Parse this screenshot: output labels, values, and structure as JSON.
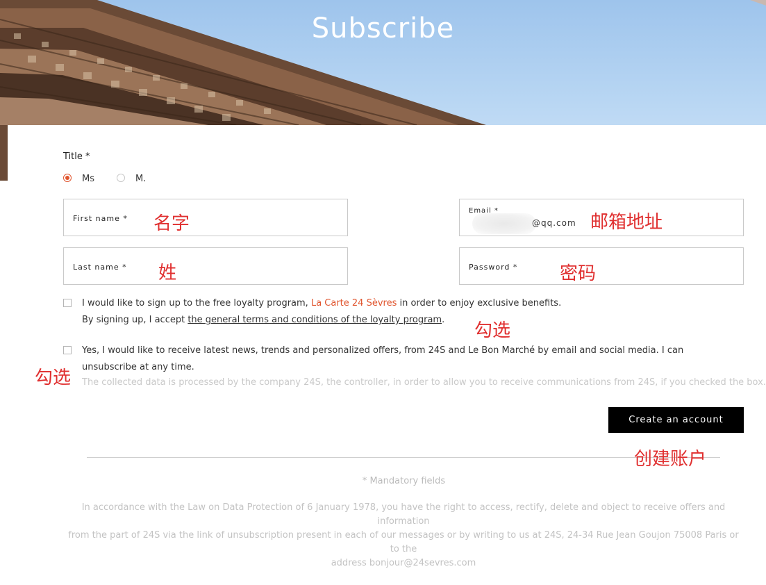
{
  "header": {
    "title": "Subscribe"
  },
  "form": {
    "title_label": "Title *",
    "title_options": [
      {
        "label": "Ms",
        "checked": true
      },
      {
        "label": "M.",
        "checked": false
      }
    ],
    "first_name": {
      "label": "First name *",
      "value": ""
    },
    "last_name": {
      "label": "Last name *",
      "value": ""
    },
    "email": {
      "label": "Email *",
      "value": "@qq.com"
    },
    "password": {
      "label": "Password *",
      "value": ""
    },
    "loyalty": {
      "checked": false,
      "text_before": "I would like to sign up to the free loyalty program, ",
      "program_link": "La Carte 24 Sèvres",
      "text_after": " in order to enjoy exclusive benefits.",
      "accept_before": "By signing up, I accept ",
      "terms_link": "the general terms and conditions of the loyalty program",
      "accept_after": "."
    },
    "newsletter": {
      "checked": false,
      "line1": "Yes, I would like to receive latest news, trends and personalized offers, from 24S and Le Bon Marché by email and social media. I can",
      "line2": "unsubscribe at any time.",
      "note": "The collected data is processed by the company 24S, the controller, in order to allow you to receive communications from 24S, if you checked the box."
    },
    "submit_label": "Create an account"
  },
  "footer": {
    "mandatory": "* Mandatory fields",
    "legal_lines": [
      "In accordance with the Law on Data Protection of 6 January 1978, you have the right to access, rectify, delete and object to receive offers and information",
      "from the part of 24S via the link of unsubscription present in each of our messages or by writing to us at 24S, 24-34 Rue Jean Goujon 75008 Paris or to the",
      "address bonjour@24sevres.com"
    ]
  },
  "annotations": {
    "first_name": "名字",
    "last_name": "姓",
    "email": "邮箱地址",
    "password": "密码",
    "check_loyalty": "勾选",
    "check_newsletter": "勾选",
    "create_account": "创建账户"
  },
  "colors": {
    "accent": "#e0542d",
    "button": "#000000",
    "annotation": "#e03030"
  }
}
